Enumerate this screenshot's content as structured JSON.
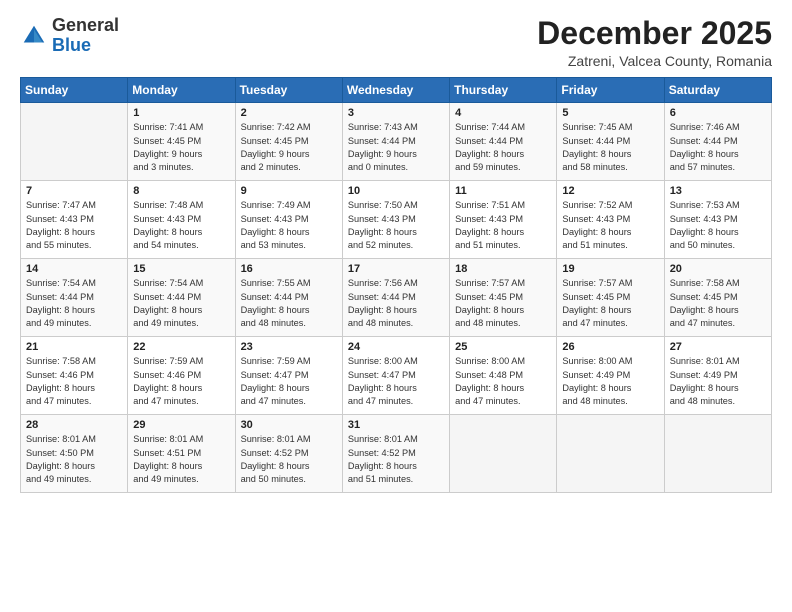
{
  "logo": {
    "general": "General",
    "blue": "Blue"
  },
  "title": "December 2025",
  "location": "Zatreni, Valcea County, Romania",
  "days_of_week": [
    "Sunday",
    "Monday",
    "Tuesday",
    "Wednesday",
    "Thursday",
    "Friday",
    "Saturday"
  ],
  "weeks": [
    [
      {
        "day": "",
        "info": ""
      },
      {
        "day": "1",
        "info": "Sunrise: 7:41 AM\nSunset: 4:45 PM\nDaylight: 9 hours\nand 3 minutes."
      },
      {
        "day": "2",
        "info": "Sunrise: 7:42 AM\nSunset: 4:45 PM\nDaylight: 9 hours\nand 2 minutes."
      },
      {
        "day": "3",
        "info": "Sunrise: 7:43 AM\nSunset: 4:44 PM\nDaylight: 9 hours\nand 0 minutes."
      },
      {
        "day": "4",
        "info": "Sunrise: 7:44 AM\nSunset: 4:44 PM\nDaylight: 8 hours\nand 59 minutes."
      },
      {
        "day": "5",
        "info": "Sunrise: 7:45 AM\nSunset: 4:44 PM\nDaylight: 8 hours\nand 58 minutes."
      },
      {
        "day": "6",
        "info": "Sunrise: 7:46 AM\nSunset: 4:44 PM\nDaylight: 8 hours\nand 57 minutes."
      }
    ],
    [
      {
        "day": "7",
        "info": "Sunrise: 7:47 AM\nSunset: 4:43 PM\nDaylight: 8 hours\nand 55 minutes."
      },
      {
        "day": "8",
        "info": "Sunrise: 7:48 AM\nSunset: 4:43 PM\nDaylight: 8 hours\nand 54 minutes."
      },
      {
        "day": "9",
        "info": "Sunrise: 7:49 AM\nSunset: 4:43 PM\nDaylight: 8 hours\nand 53 minutes."
      },
      {
        "day": "10",
        "info": "Sunrise: 7:50 AM\nSunset: 4:43 PM\nDaylight: 8 hours\nand 52 minutes."
      },
      {
        "day": "11",
        "info": "Sunrise: 7:51 AM\nSunset: 4:43 PM\nDaylight: 8 hours\nand 51 minutes."
      },
      {
        "day": "12",
        "info": "Sunrise: 7:52 AM\nSunset: 4:43 PM\nDaylight: 8 hours\nand 51 minutes."
      },
      {
        "day": "13",
        "info": "Sunrise: 7:53 AM\nSunset: 4:43 PM\nDaylight: 8 hours\nand 50 minutes."
      }
    ],
    [
      {
        "day": "14",
        "info": "Sunrise: 7:54 AM\nSunset: 4:44 PM\nDaylight: 8 hours\nand 49 minutes."
      },
      {
        "day": "15",
        "info": "Sunrise: 7:54 AM\nSunset: 4:44 PM\nDaylight: 8 hours\nand 49 minutes."
      },
      {
        "day": "16",
        "info": "Sunrise: 7:55 AM\nSunset: 4:44 PM\nDaylight: 8 hours\nand 48 minutes."
      },
      {
        "day": "17",
        "info": "Sunrise: 7:56 AM\nSunset: 4:44 PM\nDaylight: 8 hours\nand 48 minutes."
      },
      {
        "day": "18",
        "info": "Sunrise: 7:57 AM\nSunset: 4:45 PM\nDaylight: 8 hours\nand 48 minutes."
      },
      {
        "day": "19",
        "info": "Sunrise: 7:57 AM\nSunset: 4:45 PM\nDaylight: 8 hours\nand 47 minutes."
      },
      {
        "day": "20",
        "info": "Sunrise: 7:58 AM\nSunset: 4:45 PM\nDaylight: 8 hours\nand 47 minutes."
      }
    ],
    [
      {
        "day": "21",
        "info": "Sunrise: 7:58 AM\nSunset: 4:46 PM\nDaylight: 8 hours\nand 47 minutes."
      },
      {
        "day": "22",
        "info": "Sunrise: 7:59 AM\nSunset: 4:46 PM\nDaylight: 8 hours\nand 47 minutes."
      },
      {
        "day": "23",
        "info": "Sunrise: 7:59 AM\nSunset: 4:47 PM\nDaylight: 8 hours\nand 47 minutes."
      },
      {
        "day": "24",
        "info": "Sunrise: 8:00 AM\nSunset: 4:47 PM\nDaylight: 8 hours\nand 47 minutes."
      },
      {
        "day": "25",
        "info": "Sunrise: 8:00 AM\nSunset: 4:48 PM\nDaylight: 8 hours\nand 47 minutes."
      },
      {
        "day": "26",
        "info": "Sunrise: 8:00 AM\nSunset: 4:49 PM\nDaylight: 8 hours\nand 48 minutes."
      },
      {
        "day": "27",
        "info": "Sunrise: 8:01 AM\nSunset: 4:49 PM\nDaylight: 8 hours\nand 48 minutes."
      }
    ],
    [
      {
        "day": "28",
        "info": "Sunrise: 8:01 AM\nSunset: 4:50 PM\nDaylight: 8 hours\nand 49 minutes."
      },
      {
        "day": "29",
        "info": "Sunrise: 8:01 AM\nSunset: 4:51 PM\nDaylight: 8 hours\nand 49 minutes."
      },
      {
        "day": "30",
        "info": "Sunrise: 8:01 AM\nSunset: 4:52 PM\nDaylight: 8 hours\nand 50 minutes."
      },
      {
        "day": "31",
        "info": "Sunrise: 8:01 AM\nSunset: 4:52 PM\nDaylight: 8 hours\nand 51 minutes."
      },
      {
        "day": "",
        "info": ""
      },
      {
        "day": "",
        "info": ""
      },
      {
        "day": "",
        "info": ""
      }
    ]
  ]
}
